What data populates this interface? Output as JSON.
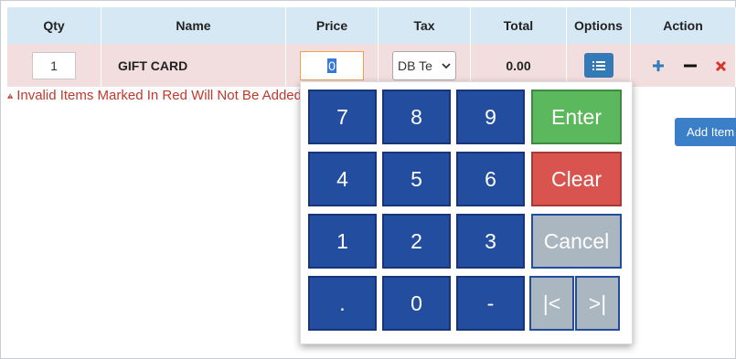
{
  "table": {
    "headers": [
      "Qty",
      "Name",
      "Price",
      "Tax",
      "Total",
      "Options",
      "Action"
    ],
    "row": {
      "qty": "1",
      "name": "GIFT CARD",
      "price": "0",
      "tax": "DB Te",
      "total": "0.00"
    }
  },
  "warning": "Invalid Items Marked In Red Will Not Be Added",
  "add_item_label": "Add Item",
  "keypad": {
    "keys": [
      "7",
      "8",
      "9",
      "4",
      "5",
      "6",
      "1",
      "2",
      "3",
      ".",
      "0",
      "-"
    ],
    "enter": "Enter",
    "clear": "Clear",
    "cancel": "Cancel",
    "first": "|<",
    "last": ">|"
  },
  "colors": {
    "header_bg": "#d7e8f5",
    "invalid_row_bg": "#f2dede",
    "key_blue": "#234ea0",
    "enter_green": "#5cb85c",
    "clear_red": "#d9534f",
    "cancel_gray": "#aab6c0"
  }
}
